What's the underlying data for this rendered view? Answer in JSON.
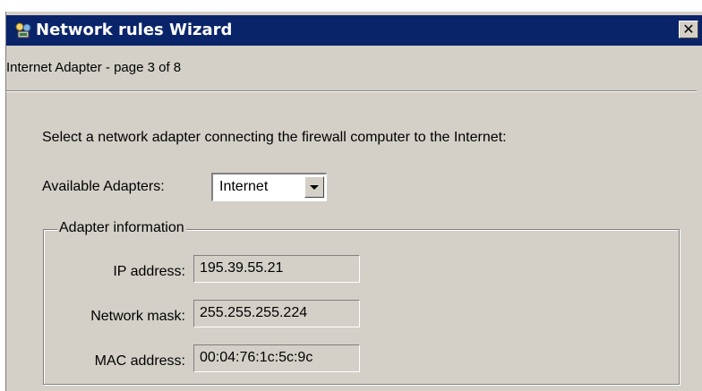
{
  "window": {
    "title": "Network rules Wizard",
    "close_glyph": "✕",
    "icon": "network-wizard-icon",
    "titlebar_color": "#0a246a"
  },
  "page": {
    "subtitle": "Internet Adapter - page 3 of 8",
    "instruction": "Select a network adapter connecting the firewall computer to the Internet:"
  },
  "adapters": {
    "label": "Available Adapters:",
    "selected": "Internet"
  },
  "adapter_info": {
    "legend": "Adapter information",
    "fields": [
      {
        "label": "IP address:",
        "value": "195.39.55.21"
      },
      {
        "label": "Network mask:",
        "value": "255.255.255.224"
      },
      {
        "label": "MAC address:",
        "value": "00:04:76:1c:5c:9c"
      }
    ]
  }
}
